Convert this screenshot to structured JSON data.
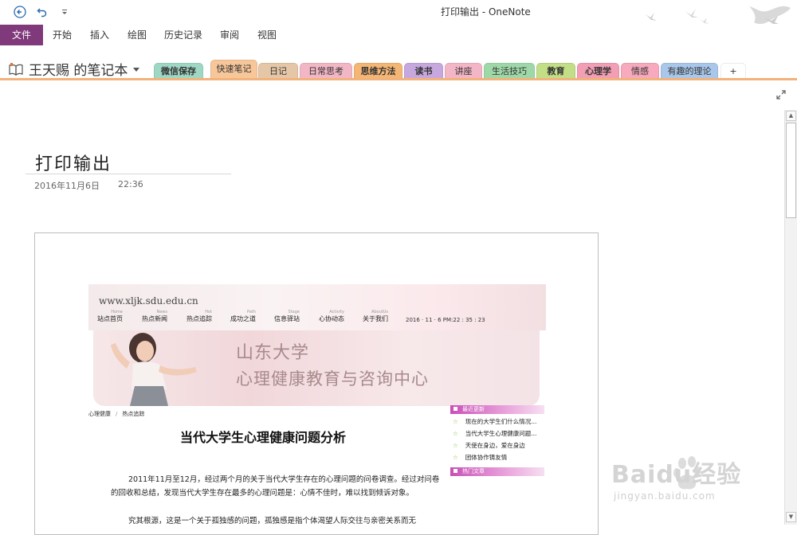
{
  "window": {
    "title": "打印输出 - OneNote"
  },
  "ribbon": {
    "tabs": [
      "文件",
      "开始",
      "插入",
      "绘图",
      "历史记录",
      "审阅",
      "视图"
    ]
  },
  "notebook": {
    "name": "王天赐 的笔记本",
    "sections": [
      {
        "label": "微信保存",
        "color": "#9fd7c5",
        "bold": true
      },
      {
        "label": "快速笔记",
        "color": "#f7c79a",
        "active": true
      },
      {
        "label": "日记",
        "color": "#e5c7a8"
      },
      {
        "label": "日常思考",
        "color": "#f2b7c5"
      },
      {
        "label": "思维方法",
        "color": "#f4b675",
        "bold": true
      },
      {
        "label": "读书",
        "color": "#c7a8de",
        "bold": true
      },
      {
        "label": "讲座",
        "color": "#f3b6c6"
      },
      {
        "label": "生活技巧",
        "color": "#9fd8a8"
      },
      {
        "label": "教育",
        "color": "#c2de86",
        "bold": true
      },
      {
        "label": "心理学",
        "color": "#f29fb5",
        "bold": true
      },
      {
        "label": "情感",
        "color": "#f7a9bd"
      },
      {
        "label": "有趣的理论",
        "color": "#a9c7ea"
      },
      {
        "label": "+",
        "color": "#ffffff"
      }
    ]
  },
  "page": {
    "title": "打印输出",
    "date": "2016年11月6日",
    "time": "22:36"
  },
  "printout": {
    "site_url": "www.xljk.sdu.edu.cn",
    "nav": [
      {
        "cn": "站点首页",
        "en": "Home"
      },
      {
        "cn": "热点新闻",
        "en": "News"
      },
      {
        "cn": "热点追踪",
        "en": "Hot"
      },
      {
        "cn": "成功之道",
        "en": "Path"
      },
      {
        "cn": "信息驿站",
        "en": "Stage"
      },
      {
        "cn": "心协动态",
        "en": "Activity"
      },
      {
        "cn": "关于我们",
        "en": "AboutUs"
      }
    ],
    "datetime": "2016 · 11 · 6    PM:22 : 35 : 23",
    "banner_line1": "山东大学",
    "banner_line2": "心理健康教育与咨询中心",
    "breadcrumb": [
      "心理健康",
      "热点追踪"
    ],
    "article_title": "当代大学生心理健康问题分析",
    "paragraph1": "2011年11月至12月，经过两个月的关于当代大学生存在的心理问题的问卷调查。经过对问卷的回收和总结，发现当代大学生存在最多的心理问题是：心情不佳时，难以找到倾诉对象。",
    "paragraph2": "究其根源，这是一个关于孤独感的问题，孤独感是指个体渴望人际交往与亲密关系而无",
    "sidebar": {
      "recent_header": "最近更新",
      "recent_items": [
        "现在的大学生们什么情况...",
        "当代大学生心理健康问题...",
        "天使在身边，爱在身边",
        "团体协作铸友情"
      ],
      "hot_header": "热门文章"
    }
  },
  "watermark": {
    "text": "Baidu经验",
    "url": "jingyan.baidu.com"
  }
}
